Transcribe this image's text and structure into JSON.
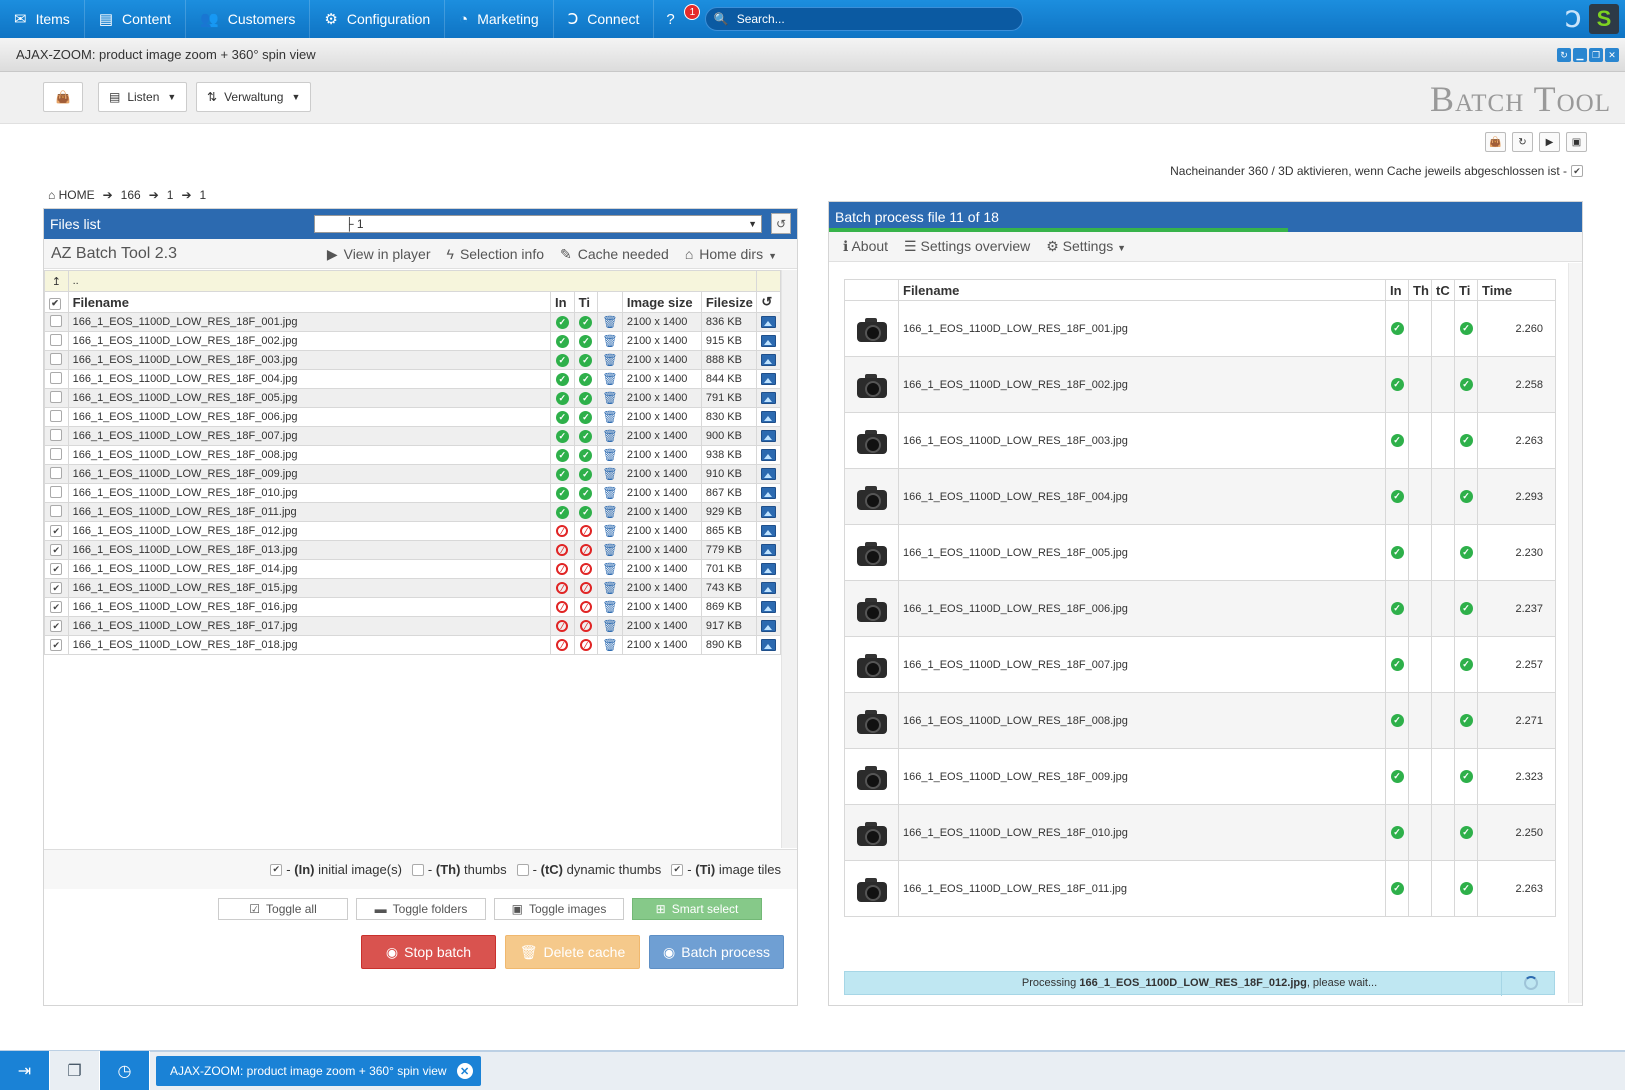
{
  "nav": {
    "items": [
      {
        "label": "Items",
        "icon": "envelope-icon"
      },
      {
        "label": "Content",
        "icon": "book-icon"
      },
      {
        "label": "Customers",
        "icon": "users-icon"
      },
      {
        "label": "Configuration",
        "icon": "gear-icon"
      },
      {
        "label": "Marketing",
        "icon": "pie-chart-icon"
      },
      {
        "label": "Connect",
        "icon": "shopware-icon"
      }
    ],
    "help_badge": "1",
    "search_placeholder": "Search..."
  },
  "window": {
    "title": "AJAX-ZOOM: product image zoom + 360° spin view"
  },
  "toolbar": {
    "listen": "Listen",
    "verwaltung": "Verwaltung",
    "page_title": "Batch Tool"
  },
  "sequential_label": "Nacheinander 360 / 3D aktivieren, wenn Cache jeweils abgeschlossen ist -",
  "breadcrumb": {
    "home": "HOME",
    "parts": [
      "166",
      "1",
      "1"
    ]
  },
  "files": {
    "header": "Files list",
    "dir_value": "├ 1",
    "tool_title": "AZ Batch Tool 2.3",
    "links": {
      "view": "View in player",
      "selection": "Selection info",
      "cache": "Cache needed",
      "home": "Home dirs"
    },
    "up_label": "..",
    "columns": {
      "filename": "Filename",
      "in": "In",
      "ti": "Ti",
      "size": "Image size",
      "filesize": "Filesize"
    },
    "rows": [
      {
        "name": "166_1_EOS_1100D_LOW_RES_18F_001.jpg",
        "size": "2100 x 1400",
        "filesize": "836 KB",
        "done": true
      },
      {
        "name": "166_1_EOS_1100D_LOW_RES_18F_002.jpg",
        "size": "2100 x 1400",
        "filesize": "915 KB",
        "done": true
      },
      {
        "name": "166_1_EOS_1100D_LOW_RES_18F_003.jpg",
        "size": "2100 x 1400",
        "filesize": "888 KB",
        "done": true
      },
      {
        "name": "166_1_EOS_1100D_LOW_RES_18F_004.jpg",
        "size": "2100 x 1400",
        "filesize": "844 KB",
        "done": true
      },
      {
        "name": "166_1_EOS_1100D_LOW_RES_18F_005.jpg",
        "size": "2100 x 1400",
        "filesize": "791 KB",
        "done": true
      },
      {
        "name": "166_1_EOS_1100D_LOW_RES_18F_006.jpg",
        "size": "2100 x 1400",
        "filesize": "830 KB",
        "done": true
      },
      {
        "name": "166_1_EOS_1100D_LOW_RES_18F_007.jpg",
        "size": "2100 x 1400",
        "filesize": "900 KB",
        "done": true
      },
      {
        "name": "166_1_EOS_1100D_LOW_RES_18F_008.jpg",
        "size": "2100 x 1400",
        "filesize": "938 KB",
        "done": true
      },
      {
        "name": "166_1_EOS_1100D_LOW_RES_18F_009.jpg",
        "size": "2100 x 1400",
        "filesize": "910 KB",
        "done": true
      },
      {
        "name": "166_1_EOS_1100D_LOW_RES_18F_010.jpg",
        "size": "2100 x 1400",
        "filesize": "867 KB",
        "done": true
      },
      {
        "name": "166_1_EOS_1100D_LOW_RES_18F_011.jpg",
        "size": "2100 x 1400",
        "filesize": "929 KB",
        "done": true
      },
      {
        "name": "166_1_EOS_1100D_LOW_RES_18F_012.jpg",
        "size": "2100 x 1400",
        "filesize": "865 KB",
        "done": false
      },
      {
        "name": "166_1_EOS_1100D_LOW_RES_18F_013.jpg",
        "size": "2100 x 1400",
        "filesize": "779 KB",
        "done": false
      },
      {
        "name": "166_1_EOS_1100D_LOW_RES_18F_014.jpg",
        "size": "2100 x 1400",
        "filesize": "701 KB",
        "done": false
      },
      {
        "name": "166_1_EOS_1100D_LOW_RES_18F_015.jpg",
        "size": "2100 x 1400",
        "filesize": "743 KB",
        "done": false
      },
      {
        "name": "166_1_EOS_1100D_LOW_RES_18F_016.jpg",
        "size": "2100 x 1400",
        "filesize": "869 KB",
        "done": false
      },
      {
        "name": "166_1_EOS_1100D_LOW_RES_18F_017.jpg",
        "size": "2100 x 1400",
        "filesize": "917 KB",
        "done": false
      },
      {
        "name": "166_1_EOS_1100D_LOW_RES_18F_018.jpg",
        "size": "2100 x 1400",
        "filesize": "890 KB",
        "done": false
      }
    ],
    "legend": {
      "in": {
        "code": "(In)",
        "text": "initial image(s)"
      },
      "th": {
        "code": "(Th)",
        "text": "thumbs"
      },
      "tc": {
        "code": "(tC)",
        "text": "dynamic thumbs"
      },
      "ti": {
        "code": "(Ti)",
        "text": "image tiles"
      }
    },
    "buttons": {
      "toggle_all": "Toggle all",
      "toggle_folders": "Toggle folders",
      "toggle_images": "Toggle images",
      "smart_select": "Smart select",
      "stop": "Stop batch",
      "delete": "Delete cache",
      "process": "Batch process"
    }
  },
  "batch": {
    "header": "Batch process file 11 of 18",
    "progress": 0.61,
    "links": {
      "about": "About",
      "overview": "Settings overview",
      "settings": "Settings"
    },
    "columns": {
      "filename": "Filename",
      "in": "In",
      "th": "Th",
      "tc": "tC",
      "ti": "Ti",
      "time": "Time"
    },
    "rows": [
      {
        "name": "166_1_EOS_1100D_LOW_RES_18F_001.jpg",
        "time": "2.260"
      },
      {
        "name": "166_1_EOS_1100D_LOW_RES_18F_002.jpg",
        "time": "2.258"
      },
      {
        "name": "166_1_EOS_1100D_LOW_RES_18F_003.jpg",
        "time": "2.263"
      },
      {
        "name": "166_1_EOS_1100D_LOW_RES_18F_004.jpg",
        "time": "2.293"
      },
      {
        "name": "166_1_EOS_1100D_LOW_RES_18F_005.jpg",
        "time": "2.230"
      },
      {
        "name": "166_1_EOS_1100D_LOW_RES_18F_006.jpg",
        "time": "2.237"
      },
      {
        "name": "166_1_EOS_1100D_LOW_RES_18F_007.jpg",
        "time": "2.257"
      },
      {
        "name": "166_1_EOS_1100D_LOW_RES_18F_008.jpg",
        "time": "2.271"
      },
      {
        "name": "166_1_EOS_1100D_LOW_RES_18F_009.jpg",
        "time": "2.323"
      },
      {
        "name": "166_1_EOS_1100D_LOW_RES_18F_010.jpg",
        "time": "2.250"
      },
      {
        "name": "166_1_EOS_1100D_LOW_RES_18F_011.jpg",
        "time": "2.263"
      }
    ],
    "processing_prefix": "Processing",
    "processing_file": "166_1_EOS_1100D_LOW_RES_18F_012.jpg",
    "processing_suffix": ", please wait..."
  },
  "taskbar": {
    "tab_label": "AJAX-ZOOM: product image zoom + 360° spin view"
  }
}
